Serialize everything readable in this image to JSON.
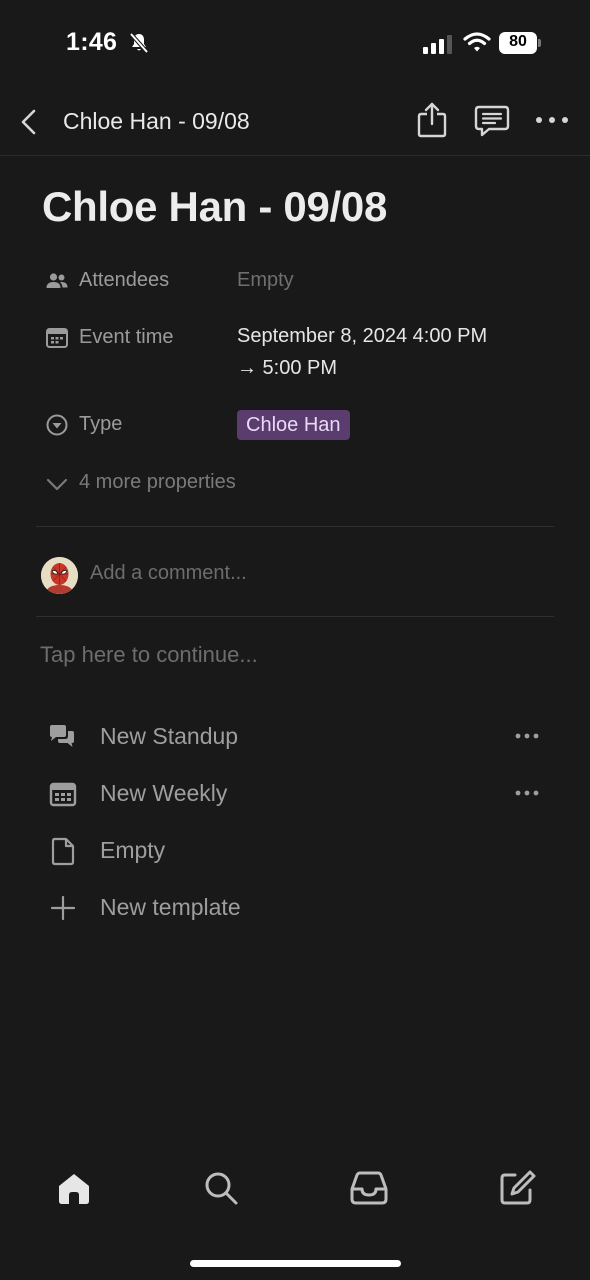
{
  "status_bar": {
    "time": "1:46",
    "battery": "80"
  },
  "nav": {
    "title": "Chloe Han - 09/08"
  },
  "page": {
    "title": "Chloe Han - 09/08"
  },
  "properties": {
    "attendees": {
      "label": "Attendees",
      "value": "Empty"
    },
    "event_time": {
      "label": "Event time",
      "value_line1": "September 8, 2024 4:00 PM",
      "value_line2": "→ 5:00 PM"
    },
    "type": {
      "label": "Type",
      "value": "Chloe Han",
      "tag_color": "#5a3d6e"
    },
    "more": "4 more properties"
  },
  "comment": {
    "placeholder": "Add a comment..."
  },
  "body": {
    "placeholder": "Tap here to continue..."
  },
  "templates": [
    {
      "label": "New Standup",
      "icon": "chat-bubbles-icon"
    },
    {
      "label": "New Weekly",
      "icon": "calendar-icon"
    },
    {
      "label": "Empty",
      "icon": "document-icon"
    },
    {
      "label": "New template",
      "icon": "plus-icon"
    }
  ],
  "tab_bar": [
    "home-icon",
    "search-icon",
    "inbox-icon",
    "compose-icon"
  ],
  "colors": {
    "background": "#191919",
    "tag_background": "#5a3d6e"
  }
}
